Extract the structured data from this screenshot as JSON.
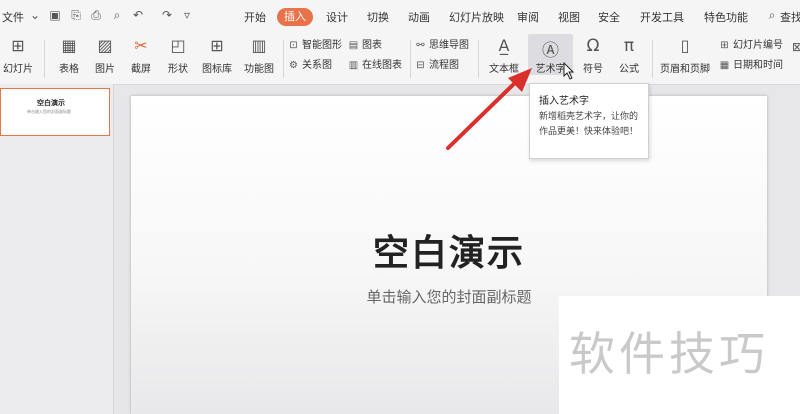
{
  "menubar": {
    "file": "文件",
    "tabs": [
      "开始",
      "插入",
      "设计",
      "切换",
      "动画",
      "幻灯片放映",
      "审阅",
      "视图",
      "安全",
      "开发工具",
      "特色功能"
    ],
    "active_tab": "插入",
    "search": "查找"
  },
  "ribbon": {
    "new_slide": "幻灯片",
    "table": "表格",
    "picture": "图片",
    "screenshot": "截屏",
    "shape": "形状",
    "icon_lib": "图标库",
    "function_chart": "功能图",
    "smart_shape": "智能图形",
    "chart": "图表",
    "relation_chart": "关系图",
    "online_chart": "在线图表",
    "mindmap": "思维导图",
    "flowchart": "流程图",
    "textbox": "文本框",
    "wordart": "艺术字",
    "symbol": "符号",
    "formula": "公式",
    "header_footer": "页眉和页脚",
    "slide_number": "幻灯片编号",
    "datetime": "日期和时间"
  },
  "thumbnail": {
    "title": "空白演示",
    "subtitle": "单击输入您的封面副标题"
  },
  "slide": {
    "title": "空白演示",
    "subtitle": "单击输入您的封面副标题"
  },
  "tooltip": {
    "title": "插入艺术字",
    "desc": "新增稻壳艺术字，让你的作品更美！快来体验吧！"
  },
  "watermark": "软件技巧",
  "colors": {
    "accent": "#e8734a",
    "arrow": "#d9302c"
  }
}
